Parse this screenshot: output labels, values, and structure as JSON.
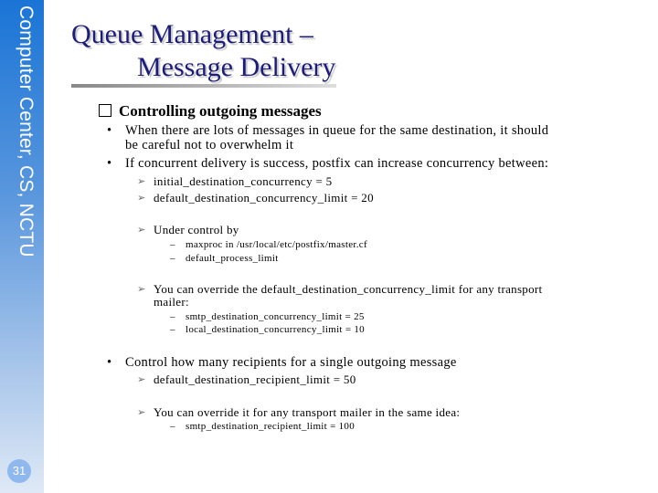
{
  "sidebar": {
    "text": "Computer Center, CS, NCTU",
    "page_number": "31"
  },
  "title": {
    "line1": "Queue Management –",
    "line2": "Message Delivery"
  },
  "content": {
    "heading": "Controlling outgoing messages",
    "bullets": [
      {
        "text": "When there are lots of messages in queue for the same destination, it should",
        "text2": "be careful not to overwhelm it"
      },
      {
        "text": "If concurrent delivery is success, postfix can increase concurrency between:",
        "subs": [
          "initial_destination_concurrency = 5",
          "default_destination_concurrency_limit = 20"
        ]
      },
      {
        "under_control": "Under control by",
        "under_items": [
          "maxproc in /usr/local/etc/postfix/master.cf",
          "default_process_limit"
        ]
      },
      {
        "override": "You can override the default_destination_concurrency_limit for any transport",
        "override2": "mailer:",
        "override_items": [
          "smtp_destination_concurrency_limit = 25",
          "local_destination_concurrency_limit = 10"
        ]
      },
      {
        "text": "Control how many recipients for a single outgoing message",
        "subs": [
          "default_destination_recipient_limit = 50",
          "You can override it for any transport mailer in the same idea:"
        ],
        "sub_items": [
          "smtp_destination_recipient_limit = 100"
        ]
      }
    ],
    "bullet_glyph": "•",
    "arrow_glyph": "➢",
    "dash_glyph": "–"
  }
}
